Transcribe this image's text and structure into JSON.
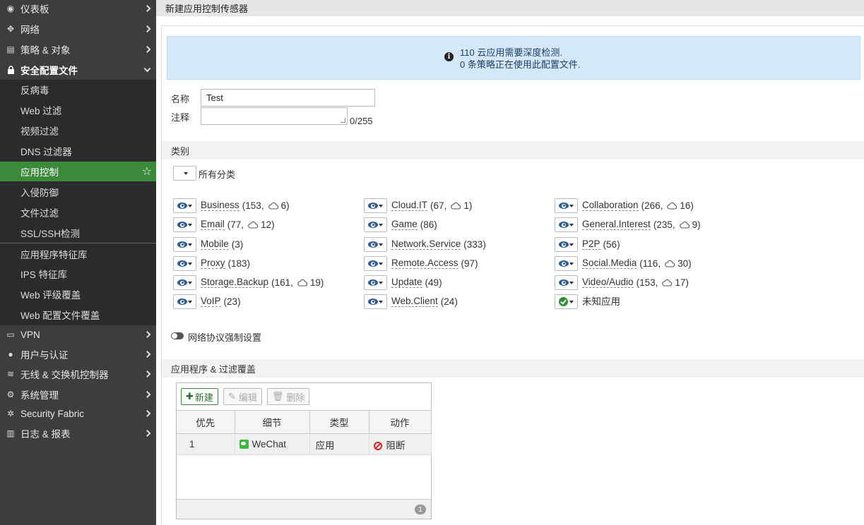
{
  "sidebar": {
    "top_items": [
      {
        "label": "仪表板",
        "icon": "dashboard-icon"
      },
      {
        "label": "网络",
        "icon": "network-icon"
      },
      {
        "label": "策略 & 对象",
        "icon": "policy-icon"
      },
      {
        "label": "安全配置文件",
        "icon": "lock-icon"
      }
    ],
    "security_sub": [
      "反病毒",
      "Web 过滤",
      "视频过滤",
      "DNS 过滤器",
      "应用控制",
      "入侵防御",
      "文件过滤",
      "SSL/SSH检测"
    ],
    "db_sub": [
      "应用程序特征库",
      "IPS 特征库",
      "Web 评级覆盖",
      "Web 配置文件覆盖"
    ],
    "bottom_items": [
      {
        "label": "VPN",
        "icon": "laptop-icon"
      },
      {
        "label": "用户与认证",
        "icon": "user-icon"
      },
      {
        "label": "无线 & 交换机控制器",
        "icon": "wifi-icon"
      },
      {
        "label": "系统管理",
        "icon": "gear-icon"
      },
      {
        "label": "Security Fabric",
        "icon": "fabric-icon"
      },
      {
        "label": "日志 & 报表",
        "icon": "chart-icon"
      }
    ]
  },
  "page": {
    "title": "新建应用控制传感器",
    "info_line1": "110 云应用需要深度检测.",
    "info_line2": "0 条策略正在使用此配置文件.",
    "name_label": "名称",
    "name_value": "Test",
    "comment_label": "注释",
    "comment_counter": "0/255",
    "categories_header": "类别",
    "all_categories": "所有分类",
    "protocol_toggle_label": "网络协议强制设置",
    "override_header": "应用程序 & 过滤覆盖"
  },
  "categories": [
    {
      "name": "Business",
      "count": "153",
      "cloud": "6"
    },
    {
      "name": "Cloud.IT",
      "count": "67",
      "cloud": "1"
    },
    {
      "name": "Collaboration",
      "count": "266",
      "cloud": "16"
    },
    {
      "name": "Email",
      "count": "77",
      "cloud": "12"
    },
    {
      "name": "Game",
      "count": "86",
      "cloud": ""
    },
    {
      "name": "General.Interest",
      "count": "235",
      "cloud": "9"
    },
    {
      "name": "Mobile",
      "count": "3",
      "cloud": ""
    },
    {
      "name": "Network.Service",
      "count": "333",
      "cloud": ""
    },
    {
      "name": "P2P",
      "count": "56",
      "cloud": ""
    },
    {
      "name": "Proxy",
      "count": "183",
      "cloud": ""
    },
    {
      "name": "Remote.Access",
      "count": "97",
      "cloud": ""
    },
    {
      "name": "Social.Media",
      "count": "116",
      "cloud": "30"
    },
    {
      "name": "Storage.Backup",
      "count": "161",
      "cloud": "19"
    },
    {
      "name": "Update",
      "count": "49",
      "cloud": ""
    },
    {
      "name": "Video/Audio",
      "count": "153",
      "cloud": "17"
    },
    {
      "name": "VoIP",
      "count": "23",
      "cloud": ""
    },
    {
      "name": "Web.Client",
      "count": "24",
      "cloud": ""
    },
    {
      "name": "未知应用",
      "count": "",
      "cloud": "",
      "allow": true
    }
  ],
  "override": {
    "new_label": "新建",
    "edit_label": "编辑",
    "delete_label": "删除",
    "columns": [
      "优先",
      "细节",
      "类型",
      "动作"
    ],
    "rows": [
      {
        "priority": "1",
        "detail": "WeChat",
        "type": "应用",
        "action": "阻断"
      }
    ],
    "total": "1"
  }
}
